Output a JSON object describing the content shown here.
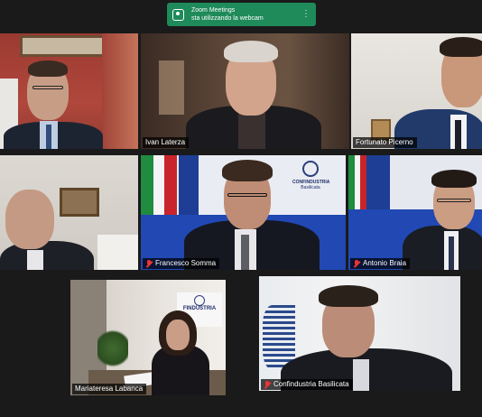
{
  "notification": {
    "title": "Zoom Meetings",
    "message": "sta utilizzando la webcam",
    "icon": "webcam-icon",
    "color": "#1f8a5a"
  },
  "participants": [
    {
      "name": "",
      "muted": false
    },
    {
      "name": "Ivan Laterza",
      "muted": false
    },
    {
      "name": "Fortunato Picerno",
      "muted": false
    },
    {
      "name": "",
      "muted": false
    },
    {
      "name": "Francesco Somma",
      "muted": true
    },
    {
      "name": "Antonio Braia",
      "muted": true
    },
    {
      "name": "Mariateresa Labanca",
      "muted": false
    },
    {
      "name": "Confindustria Basilicata",
      "muted": true
    }
  ],
  "logo_text": {
    "brand": "CONFINDUSTRIA",
    "region": "Basilicata",
    "banner_partial": "FINDUSTRIA"
  }
}
